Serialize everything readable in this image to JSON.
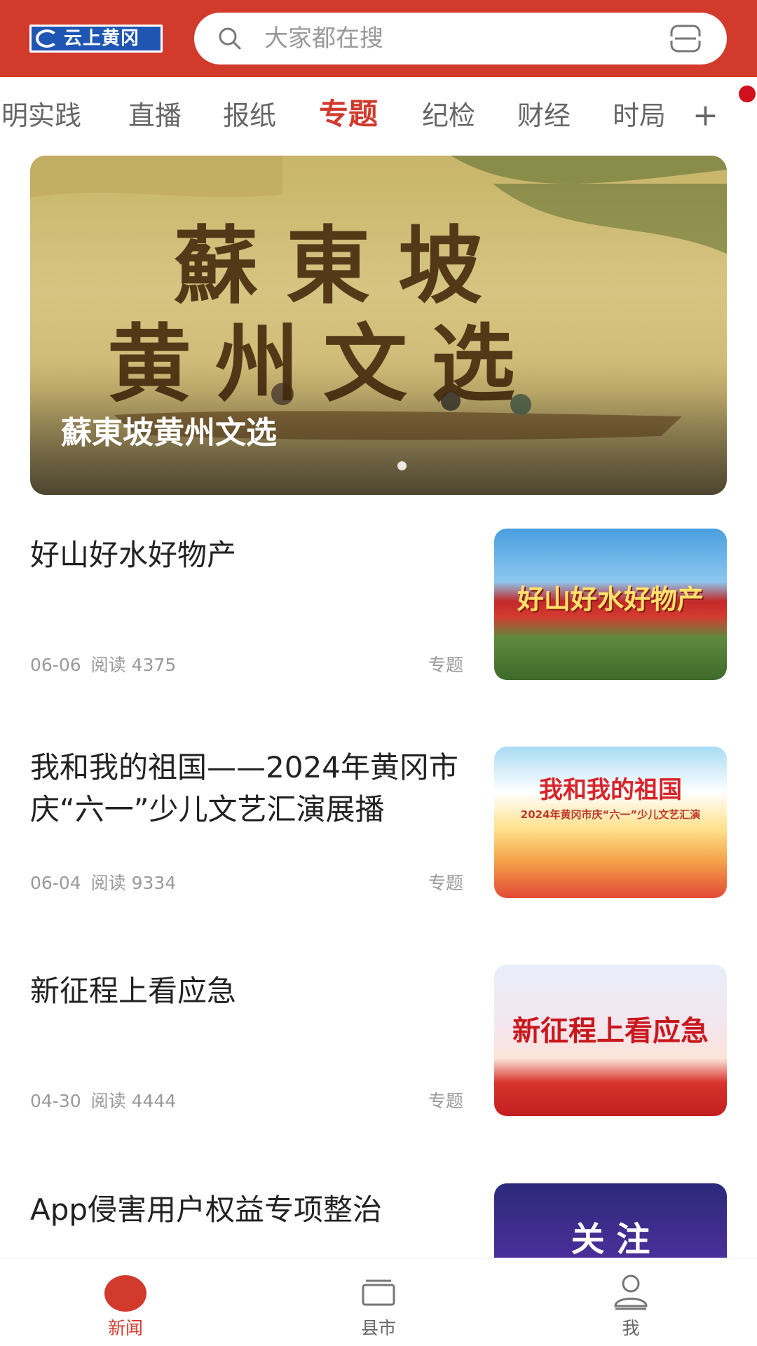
{
  "header": {
    "logo_text": "云上黄冈",
    "search_placeholder": "大家都在搜"
  },
  "tabs": [
    {
      "label": "明实践"
    },
    {
      "label": "直播"
    },
    {
      "label": "报纸"
    },
    {
      "label": "专题",
      "active": true
    },
    {
      "label": "纪检"
    },
    {
      "label": "财经"
    },
    {
      "label": "时局"
    }
  ],
  "tabs_more_label": "+",
  "banner": {
    "title": "蘇東坡黄州文选",
    "art_line_1": "蘇東坡",
    "art_line_2": "黄州文选"
  },
  "articles": [
    {
      "title": "好山好水好物产",
      "date": "06-06",
      "reads": "阅读 4375",
      "tag": "专题",
      "thumb_text": "好山好水好物产"
    },
    {
      "title": "我和我的祖国——2024年黄冈市庆“六一”少儿文艺汇演展播",
      "date": "06-04",
      "reads": "阅读 9334",
      "tag": "专题",
      "thumb_text": "我和我的祖国",
      "thumb_subtext": "2024年黄冈市庆“六一”少儿文艺汇演"
    },
    {
      "title": "新征程上看应急",
      "date": "04-30",
      "reads": "阅读 4444",
      "tag": "专题",
      "thumb_text": "新征程上看应急"
    },
    {
      "title": "App侵害用户权益专项整治",
      "thumb_text": "关 注"
    }
  ],
  "bottom_nav": [
    {
      "label": "新闻",
      "icon": "news-icon",
      "active": true
    },
    {
      "label": "县市",
      "icon": "layers-icon"
    },
    {
      "label": "我",
      "icon": "user-icon"
    }
  ],
  "colors": {
    "brand_red": "#d23a2c",
    "meta_gray": "#999999"
  }
}
